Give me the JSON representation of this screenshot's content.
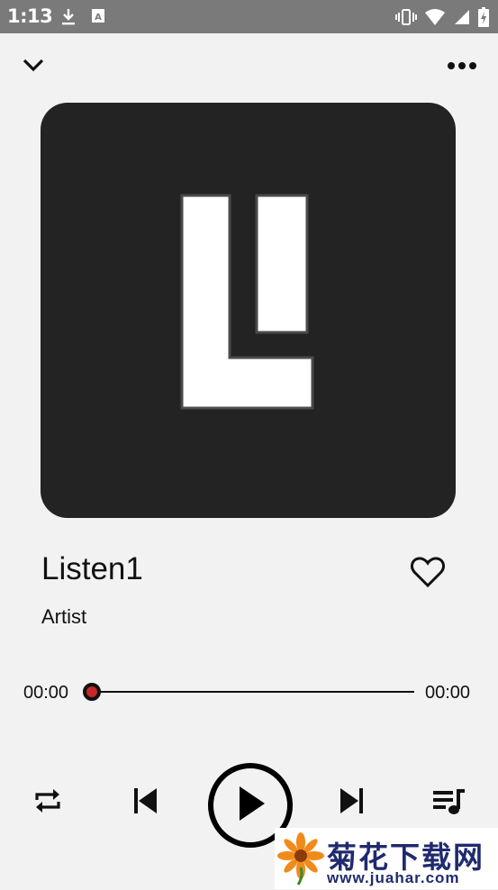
{
  "status_bar": {
    "time": "1:13",
    "icons": [
      "download-icon",
      "keyboard-a-icon",
      "vibrate-icon",
      "wifi-icon",
      "signal-icon",
      "battery-charging-icon"
    ]
  },
  "header": {
    "collapse_icon": "chevron-down-icon",
    "more_icon": "more-horizontal-icon"
  },
  "album": {
    "logo_text": "L"
  },
  "track": {
    "title": "Listen1",
    "artist": "Artist",
    "liked": false
  },
  "progress": {
    "current": "00:00",
    "total": "00:00",
    "fraction": 0
  },
  "controls": {
    "repeat_icon": "repeat-icon",
    "previous_icon": "skip-previous-icon",
    "play_icon": "play-icon",
    "next_icon": "skip-next-icon",
    "playlist_icon": "playlist-icon"
  },
  "watermark": {
    "title": "菊花下载网",
    "url": "www.juahar.com"
  },
  "colors": {
    "status_bar": "#7a7a7a",
    "background": "#f2f2f2",
    "album_bg": "#232323",
    "seek_thumb": "#c62828",
    "watermark_text": "#1f2a6e"
  }
}
